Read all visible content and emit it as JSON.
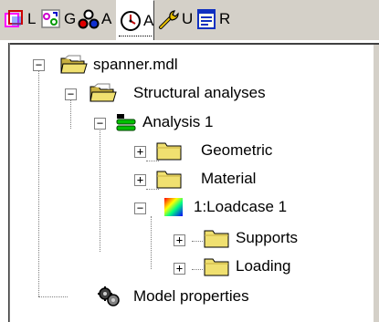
{
  "tabs": [
    {
      "label": "L",
      "icon": "layers-icon",
      "active": false
    },
    {
      "label": "G",
      "icon": "graph-icon",
      "active": false
    },
    {
      "label": "A",
      "icon": "assembly-icon",
      "active": false
    },
    {
      "label": "A",
      "icon": "analysis-clock-icon",
      "active": true
    },
    {
      "label": "U",
      "icon": "wrench-icon",
      "active": false
    },
    {
      "label": "R",
      "icon": "report-icon",
      "active": false
    }
  ],
  "tree": {
    "root": {
      "label": "spanner.mdl",
      "icon": "open-folder-icon",
      "expander": "−"
    },
    "structural": {
      "label": "Structural analyses",
      "icon": "open-folder-icon",
      "expander": "−"
    },
    "analysis": {
      "label": "Analysis 1",
      "icon": "analysis-icon",
      "expander": "−"
    },
    "geometric": {
      "label": "Geometric",
      "icon": "folder-icon",
      "expander": "+"
    },
    "material": {
      "label": "Material",
      "icon": "folder-icon",
      "expander": "+"
    },
    "loadcase": {
      "label": "1:Loadcase 1",
      "icon": "loadcase-icon",
      "expander": "−"
    },
    "supports": {
      "label": "Supports",
      "icon": "folder-icon",
      "expander": "+"
    },
    "loading": {
      "label": "Loading",
      "icon": "folder-icon",
      "expander": "+"
    },
    "model_properties": {
      "label": "Model properties",
      "icon": "gears-icon"
    }
  },
  "colors": {
    "folder": "#f0e070",
    "toolbar": "#d4d0c8"
  }
}
